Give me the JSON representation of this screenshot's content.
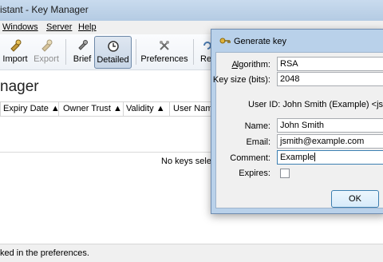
{
  "window": {
    "title": "istant - Key Manager"
  },
  "menu": [
    {
      "label": "Windows"
    },
    {
      "label": "Server"
    },
    {
      "label": "Help"
    }
  ],
  "toolbar": {
    "import": "Import",
    "export": "Export",
    "brief": "Brief",
    "detailed": "Detailed",
    "preferences": "Preferences",
    "refresh": "Ref"
  },
  "page": {
    "title": "nager"
  },
  "table": {
    "columns": [
      "Expiry Date",
      "Owner Trust",
      "Validity",
      "User Name"
    ],
    "empty_message": "No keys select"
  },
  "status": {
    "text": "ked in the preferences."
  },
  "dialog": {
    "title": "Generate key",
    "algorithm_label": "Algorithm:",
    "algorithm_value": "RSA",
    "keysize_label": "Key size (bits):",
    "keysize_value": "2048",
    "userid_text": "User ID: John Smith (Example) <jsmit",
    "name_label": "Name:",
    "name_value": "John Smith",
    "email_label": "Email:",
    "email_value": "jsmith@example.com",
    "comment_label": "Comment:",
    "comment_value": "Example",
    "expires_label": "Expires:",
    "ok_label": "OK"
  },
  "colors": {
    "dialog_frame": "#b9d1ea",
    "titlebar": "#c9dbee",
    "focus_border": "#3c7fb1"
  }
}
